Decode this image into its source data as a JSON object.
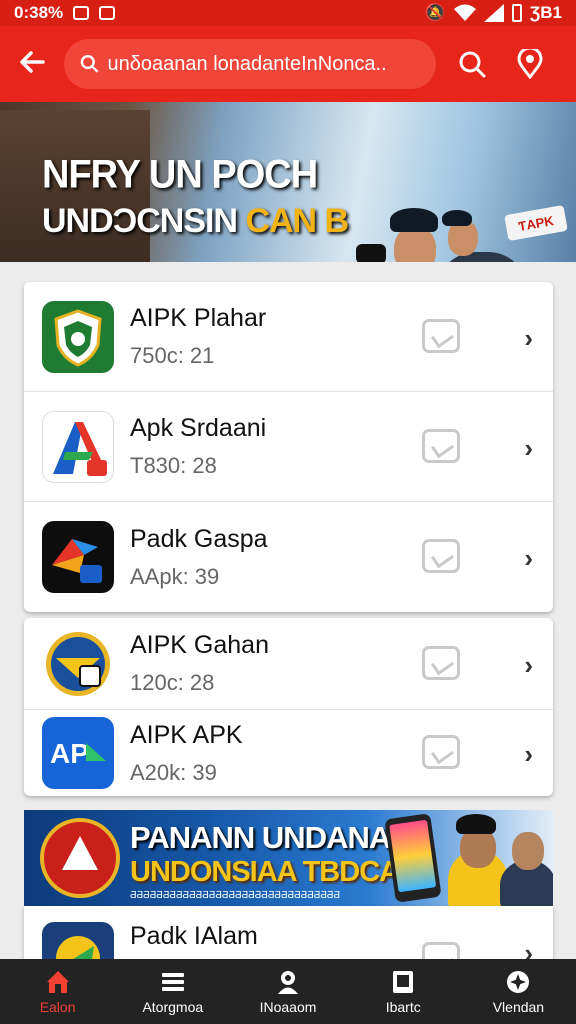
{
  "status_bar": {
    "time": "0:38%",
    "battery": "ƷB1"
  },
  "search": {
    "placeholder": "unδoaanan lonadanteInNonca.."
  },
  "banner_top": {
    "line1": "NFRY UN POCH",
    "line2_white": "UNDƆCNSIN ",
    "line2_yellow": "CAN B",
    "logo": "ƬAPK"
  },
  "apps_group1": [
    {
      "name": "AIPK Plahar",
      "meta": "750c: 21",
      "icon": "shield-app-icon"
    },
    {
      "name": "Apk Srdaani",
      "meta": "T830: 28",
      "icon": "a-logo-app-icon"
    },
    {
      "name": "Padk Gaspa",
      "meta": "AApk: 39",
      "icon": "dark-a-app-icon"
    }
  ],
  "apps_group2": [
    {
      "name": "AIPK Gahan",
      "meta": "120c: 28",
      "icon": "emblem-app-icon"
    },
    {
      "name": "AIPK APK",
      "meta": "A20k: 39",
      "icon": "apa-app-icon"
    }
  ],
  "banner_bottom": {
    "line1": "PANANN UNDANAM",
    "line2": "UNDONSIAA TBDCAP!",
    "line3": "ƋƋƋƋƋƋƋƋƋƋƋƋƋƋƋƋƋƋƋƋƋƋƋƋƋƋƋƋƋƋƋƋ"
  },
  "apps_group3": [
    {
      "name": "Padk IAlam",
      "meta": "",
      "icon": "partial-app-icon"
    }
  ],
  "bottom_nav": [
    {
      "label": "Ealon",
      "icon": "home-icon",
      "active": true
    },
    {
      "label": "Atorgmoa",
      "icon": "menu-icon",
      "active": false
    },
    {
      "label": "INoaaom",
      "icon": "person-icon",
      "active": false
    },
    {
      "label": "Ibartc",
      "icon": "book-icon",
      "active": false
    },
    {
      "label": "Vlendan",
      "icon": "compass-icon",
      "active": false
    }
  ],
  "colors": {
    "primary_red": "#e8251a",
    "status_red": "#d81f14",
    "nav_bg": "#232323",
    "active_nav": "#f24032"
  }
}
